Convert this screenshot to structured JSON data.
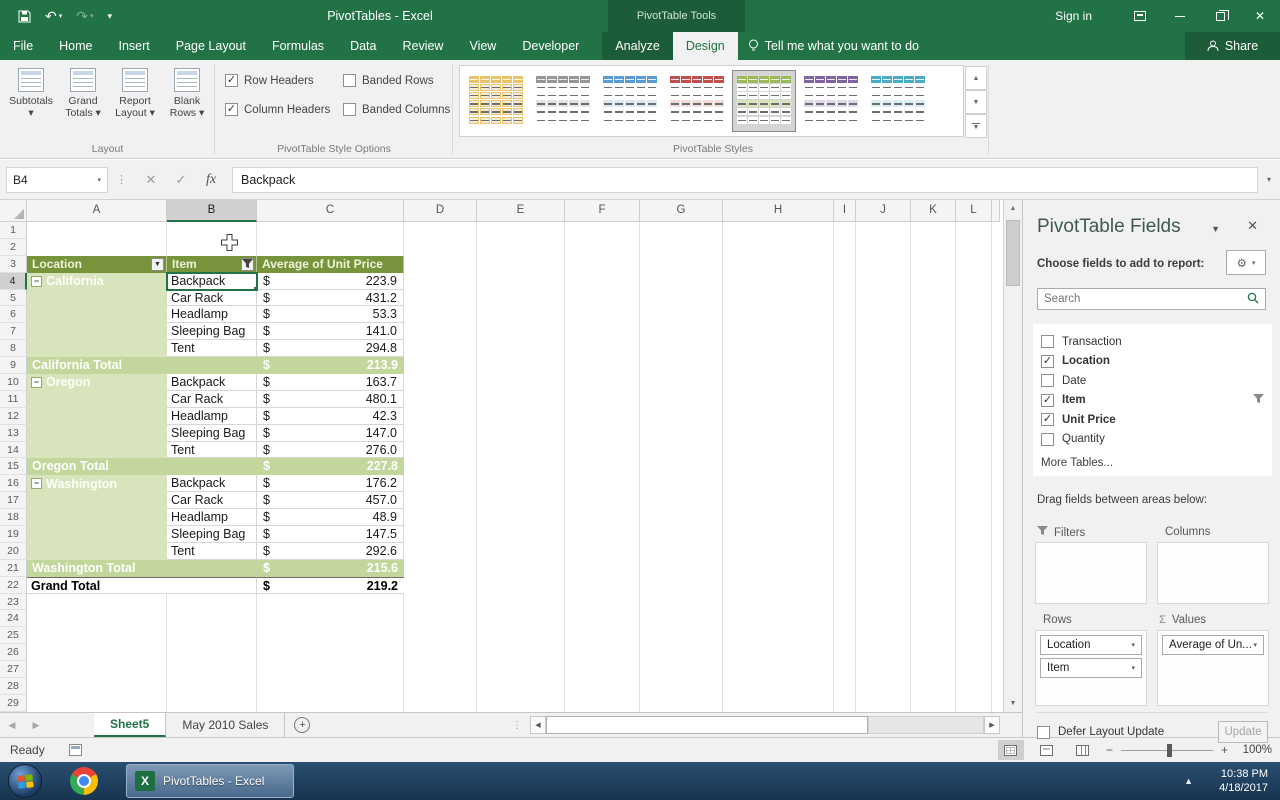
{
  "app": {
    "title": "PivotTables - Excel",
    "contextual_label": "PivotTable Tools",
    "sign_in": "Sign in",
    "tell_me": "Tell me what you want to do",
    "share": "Share"
  },
  "tabs": [
    {
      "label": "File",
      "type": "normal"
    },
    {
      "label": "Home",
      "type": "normal"
    },
    {
      "label": "Insert",
      "type": "normal"
    },
    {
      "label": "Page Layout",
      "type": "normal"
    },
    {
      "label": "Formulas",
      "type": "normal"
    },
    {
      "label": "Data",
      "type": "normal"
    },
    {
      "label": "Review",
      "type": "normal"
    },
    {
      "label": "View",
      "type": "normal"
    },
    {
      "label": "Developer",
      "type": "normal"
    },
    {
      "label": "Analyze",
      "type": "contextual"
    },
    {
      "label": "Design",
      "type": "active"
    }
  ],
  "ribbon": {
    "layout_group": {
      "label": "Layout",
      "buttons": [
        {
          "line1": "Subtotals",
          "line2": ""
        },
        {
          "line1": "Grand",
          "line2": "Totals"
        },
        {
          "line1": "Report",
          "line2": "Layout"
        },
        {
          "line1": "Blank",
          "line2": "Rows"
        }
      ]
    },
    "style_options_group": {
      "label": "PivotTable Style Options",
      "options": [
        {
          "label": "Row Headers",
          "checked": true
        },
        {
          "label": "Banded Rows",
          "checked": false
        },
        {
          "label": "Column Headers",
          "checked": true
        },
        {
          "label": "Banded Columns",
          "checked": false
        }
      ]
    },
    "styles_group": {
      "label": "PivotTable Styles",
      "thumbs": [
        {
          "name": "light-tan",
          "hdr": "#e9c46a",
          "band": "#f7ecd4",
          "outlined": true,
          "selected": false
        },
        {
          "name": "gray",
          "hdr": "#969696",
          "band": "#e3e3e3",
          "outlined": false,
          "selected": false
        },
        {
          "name": "blue",
          "hdr": "#5b9bd5",
          "band": "#dbe9f6",
          "outlined": false,
          "selected": false
        },
        {
          "name": "red",
          "hdr": "#c0504d",
          "band": "#f2dcdb",
          "outlined": false,
          "selected": false
        },
        {
          "name": "green",
          "hdr": "#9bbb59",
          "band": "#d7e4bc",
          "outlined": false,
          "selected": true
        },
        {
          "name": "purple",
          "hdr": "#8064a2",
          "band": "#e1d8ec",
          "outlined": false,
          "selected": false
        },
        {
          "name": "teal",
          "hdr": "#4bacc6",
          "band": "#d8eef3",
          "outlined": false,
          "selected": false
        }
      ]
    }
  },
  "formula_bar": {
    "name_box": "B4",
    "content": "Backpack"
  },
  "grid": {
    "columns": [
      "A",
      "B",
      "C",
      "D",
      "E",
      "F",
      "G",
      "H",
      "I",
      "J",
      "K",
      "L"
    ],
    "selected_column": "B",
    "selected_cell": "B4",
    "row_count": 29,
    "pivot": {
      "headers": [
        "Location",
        "Item",
        "Average of Unit Price"
      ],
      "currency": "$",
      "groups": [
        {
          "location": "California",
          "total_label": "California Total",
          "total": "213.9",
          "rows": [
            {
              "item": "Backpack",
              "value": "223.9"
            },
            {
              "item": "Car Rack",
              "value": "431.2"
            },
            {
              "item": "Headlamp",
              "value": "53.3"
            },
            {
              "item": "Sleeping Bag",
              "value": "141.0"
            },
            {
              "item": "Tent",
              "value": "294.8"
            }
          ]
        },
        {
          "location": "Oregon",
          "total_label": "Oregon Total",
          "total": "227.8",
          "rows": [
            {
              "item": "Backpack",
              "value": "163.7"
            },
            {
              "item": "Car Rack",
              "value": "480.1"
            },
            {
              "item": "Headlamp",
              "value": "42.3"
            },
            {
              "item": "Sleeping Bag",
              "value": "147.0"
            },
            {
              "item": "Tent",
              "value": "276.0"
            }
          ]
        },
        {
          "location": "Washington",
          "total_label": "Washington Total",
          "total": "215.6",
          "rows": [
            {
              "item": "Backpack",
              "value": "176.2"
            },
            {
              "item": "Car Rack",
              "value": "457.0"
            },
            {
              "item": "Headlamp",
              "value": "48.9"
            },
            {
              "item": "Sleeping Bag",
              "value": "147.5"
            },
            {
              "item": "Tent",
              "value": "292.6"
            }
          ]
        }
      ],
      "grand_total_label": "Grand Total",
      "grand_total": "219.2"
    }
  },
  "sheet_bar": {
    "tabs": [
      {
        "label": "Sheet5",
        "active": true
      },
      {
        "label": "May 2010 Sales",
        "active": false
      }
    ]
  },
  "status_bar": {
    "status": "Ready",
    "zoom_level": "100%"
  },
  "fields_pane": {
    "title": "PivotTable Fields",
    "choose_label": "Choose fields to add to report:",
    "search_placeholder": "Search",
    "fields": [
      {
        "label": "Transaction",
        "checked": false,
        "filtered": false
      },
      {
        "label": "Location",
        "checked": true,
        "filtered": false
      },
      {
        "label": "Date",
        "checked": false,
        "filtered": false
      },
      {
        "label": "Item",
        "checked": true,
        "filtered": true
      },
      {
        "label": "Unit Price",
        "checked": true,
        "filtered": false
      },
      {
        "label": "Quantity",
        "checked": false,
        "filtered": false
      }
    ],
    "more_tables": "More Tables...",
    "drag_label": "Drag fields between areas below:",
    "areas": [
      {
        "label": "Filters",
        "icon": "filter",
        "items": []
      },
      {
        "label": "Columns",
        "icon": "columns",
        "items": []
      },
      {
        "label": "Rows",
        "icon": "rows",
        "items": [
          "Location",
          "Item"
        ]
      },
      {
        "label": "Values",
        "icon": "sigma",
        "items": [
          "Average of Un..."
        ]
      }
    ],
    "defer_label": "Defer Layout Update",
    "update_label": "Update"
  },
  "taskbar": {
    "window_button": "PivotTables - Excel",
    "time": "10:38 PM",
    "date": "4/18/2017"
  }
}
